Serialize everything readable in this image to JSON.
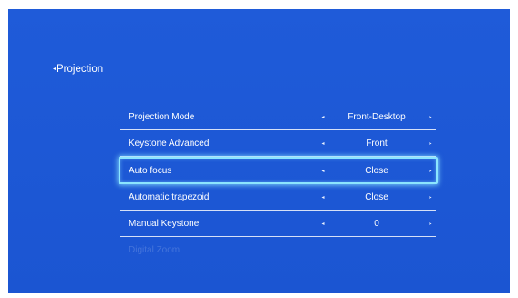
{
  "header": {
    "back_arrow": "◂",
    "title": "Projection"
  },
  "menu": {
    "items": [
      {
        "label": "Projection Mode",
        "left": "◂",
        "value": "Front-Desktop",
        "right": "▸"
      },
      {
        "label": "Keystone Advanced",
        "left": "◂",
        "value": "Front",
        "right": "▸"
      },
      {
        "label": "Auto focus",
        "left": "◂",
        "value": "Close",
        "right": "▸"
      },
      {
        "label": "Automatic trapezoid",
        "left": "◂",
        "value": "Close",
        "right": "▸"
      },
      {
        "label": "Manual Keystone",
        "left": "◂",
        "value": "0",
        "right": "▸"
      },
      {
        "label": "Digital Zoom"
      }
    ],
    "focused_index": 2
  },
  "colors": {
    "background": "#1e5ad8",
    "focus_border": "#8ce6ff",
    "text": "#ffffff"
  }
}
